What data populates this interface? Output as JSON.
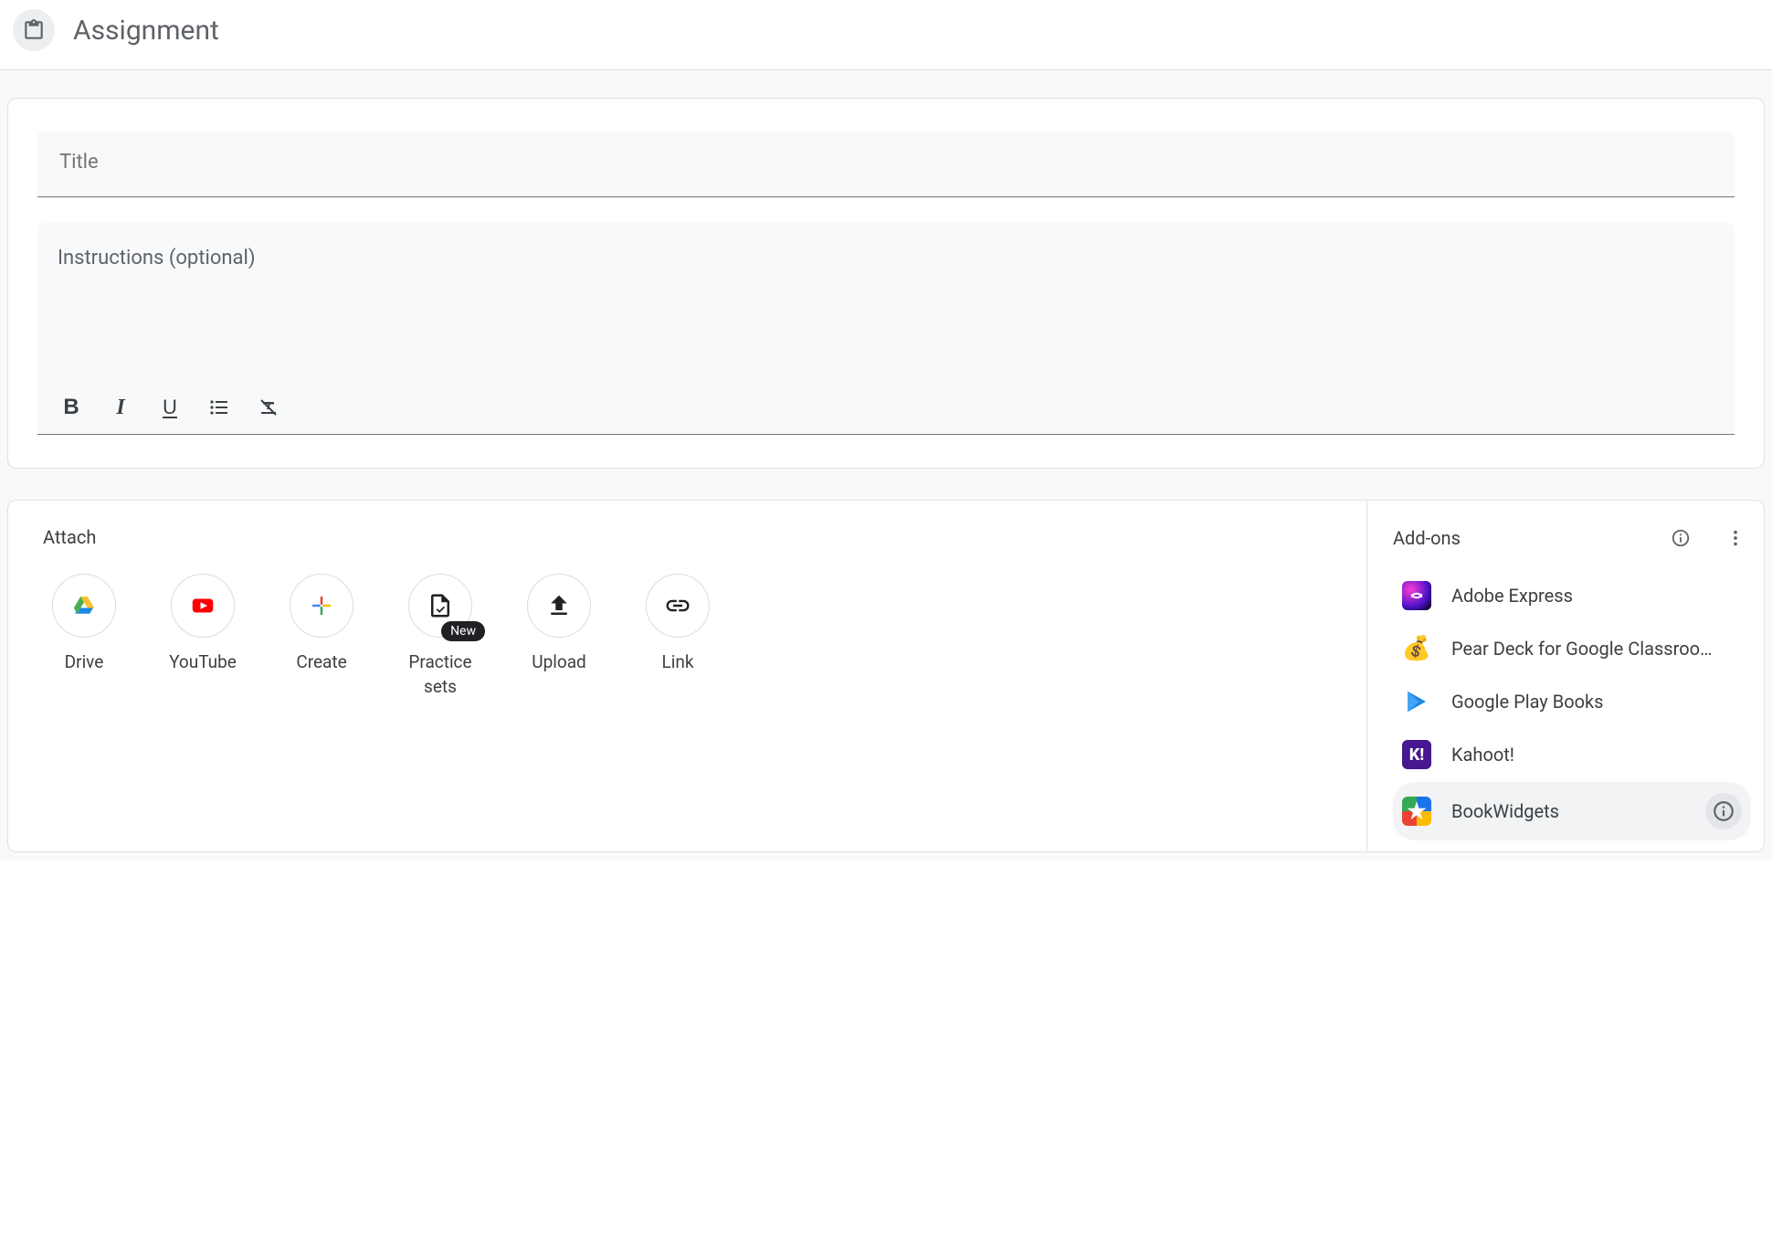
{
  "header": {
    "title": "Assignment"
  },
  "form": {
    "title_placeholder": "Title",
    "instructions_placeholder": "Instructions (optional)"
  },
  "attach": {
    "section_label": "Attach",
    "items": [
      {
        "id": "drive",
        "label": "Drive"
      },
      {
        "id": "youtube",
        "label": "YouTube"
      },
      {
        "id": "create",
        "label": "Create"
      },
      {
        "id": "practice",
        "label": "Practice sets",
        "badge": "New"
      },
      {
        "id": "upload",
        "label": "Upload"
      },
      {
        "id": "link",
        "label": "Link"
      }
    ]
  },
  "addons": {
    "section_label": "Add-ons",
    "items": [
      {
        "name": "Adobe Express"
      },
      {
        "name": "Pear Deck for Google Classroo…"
      },
      {
        "name": "Google Play Books"
      },
      {
        "name": "Kahoot!"
      },
      {
        "name": "BookWidgets",
        "selected": true
      }
    ]
  }
}
